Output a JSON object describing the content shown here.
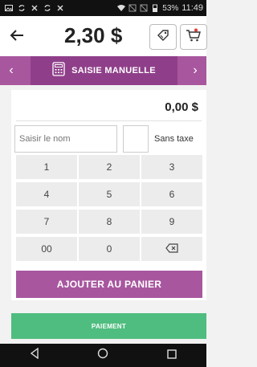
{
  "status_bar": {
    "battery": "53%",
    "time": "11:49"
  },
  "header": {
    "total": "2,30 $"
  },
  "mode_bar": {
    "label": "SAISIE MANUELLE"
  },
  "entry": {
    "amount": "0,00 $",
    "name_placeholder": "Saisir le nom",
    "tax_label": "Sans taxe"
  },
  "keypad": {
    "keys": [
      "1",
      "2",
      "3",
      "4",
      "5",
      "6",
      "7",
      "8",
      "9",
      "00",
      "0"
    ]
  },
  "actions": {
    "add_to_cart": "AJOUTER AU PANIER",
    "payment": "PAIEMENT"
  },
  "colors": {
    "purple": "#a8579f",
    "purple_dark": "#8f3f8a",
    "green": "#4fbd7f"
  }
}
